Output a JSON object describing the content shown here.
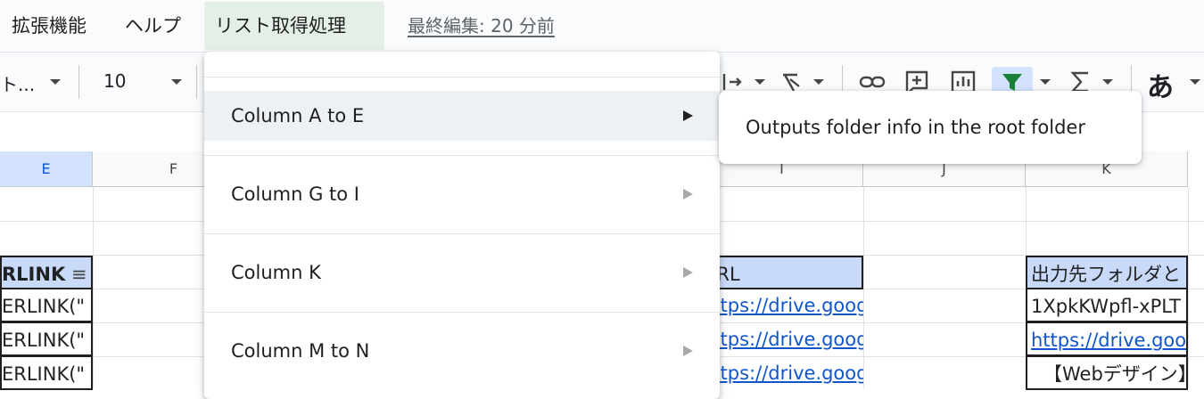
{
  "menubar": {
    "items": [
      {
        "label": "拡張機能"
      },
      {
        "label": "ヘルプ"
      },
      {
        "label": "リスト取得処理"
      }
    ],
    "last_edit": "最終編集: 20 分前"
  },
  "toolbar": {
    "font_name": "ト...",
    "font_size": "10",
    "ime_glyph": "あ",
    "icons": [
      "merge-cells-icon",
      "text-rotation-icon",
      "insert-link-icon",
      "insert-comment-icon",
      "insert-chart-icon",
      "filter-icon",
      "functions-icon",
      "input-tools-icon"
    ],
    "colors": {
      "filter_icon": "#188038",
      "active_bg": "#d3e3fd"
    }
  },
  "grid": {
    "columns": [
      "E",
      "F",
      "I",
      "J",
      "K"
    ],
    "rows": [
      {
        "e": "",
        "i": "",
        "k": ""
      },
      {
        "e": "",
        "i": "",
        "k": ""
      },
      {
        "e": "RLINK",
        "i": "URL",
        "k": "出力先フォルダと"
      },
      {
        "e": "ERLINK(\"",
        "i": "https://drive.goog",
        "k": "1XpkKWpfl-xPLT"
      },
      {
        "e": "ERLINK(\"",
        "i": "https://drive.goog",
        "k": "https://drive.goog"
      },
      {
        "e": "ERLINK(\"",
        "i": "https://drive.goog",
        "k": "【Webデザイン】"
      }
    ],
    "colors": {
      "header_fill": "#c9daf8",
      "link": "#1155cc",
      "selected_col": "#d3e3fd"
    }
  },
  "dropdown": {
    "items": [
      {
        "label": "Column A to E",
        "hovered": true
      },
      {
        "label": "Column G to I",
        "hovered": false
      },
      {
        "label": "Column K",
        "hovered": false
      },
      {
        "label": "Column M to N",
        "hovered": false
      }
    ]
  },
  "tooltip": {
    "text": "Outputs folder info in the root folder"
  }
}
